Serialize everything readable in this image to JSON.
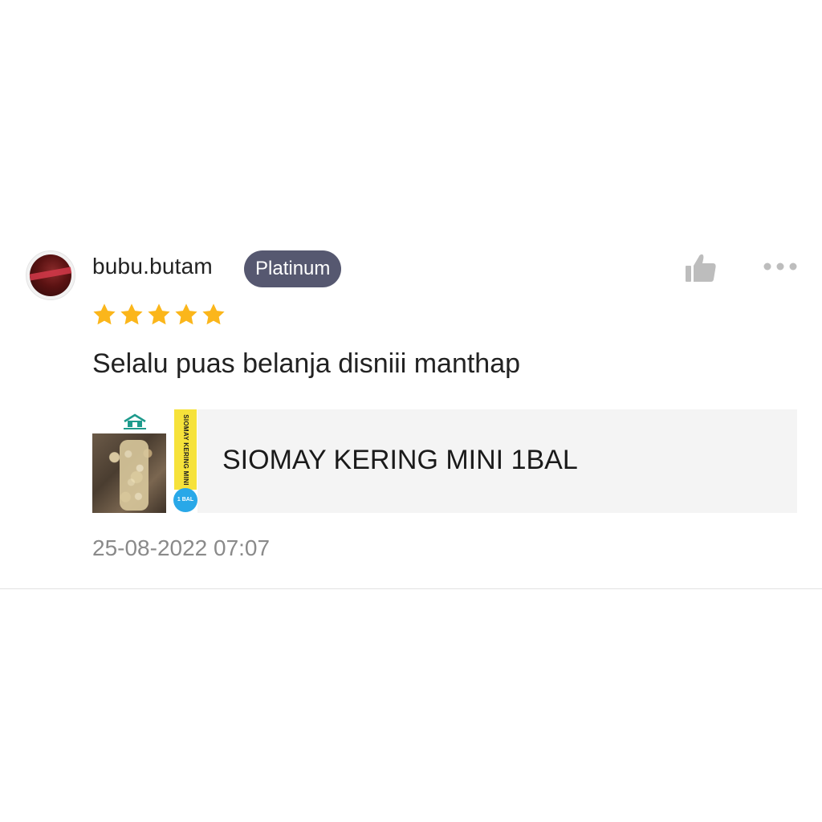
{
  "review": {
    "username": "bubu.butam",
    "badge": "Platinum",
    "rating": 5,
    "rating_max": 5,
    "comment": "Selalu puas belanja disniii manthap",
    "product": {
      "name": "SIOMAY KERING MINI 1BAL",
      "thumb_strip_text": "SIOMAY KERING MINI",
      "thumb_circle_text": "1 BAL"
    },
    "timestamp": "25-08-2022 07:07"
  },
  "icons": {
    "like": "thumbs-up-icon",
    "more": "more-options-icon",
    "star": "star-icon"
  },
  "colors": {
    "badge_bg": "#565870",
    "star": "#fbb61b",
    "icon_gray": "#bdbdbd",
    "timestamp": "#8a8a8a",
    "card_bg": "#f4f4f4"
  }
}
